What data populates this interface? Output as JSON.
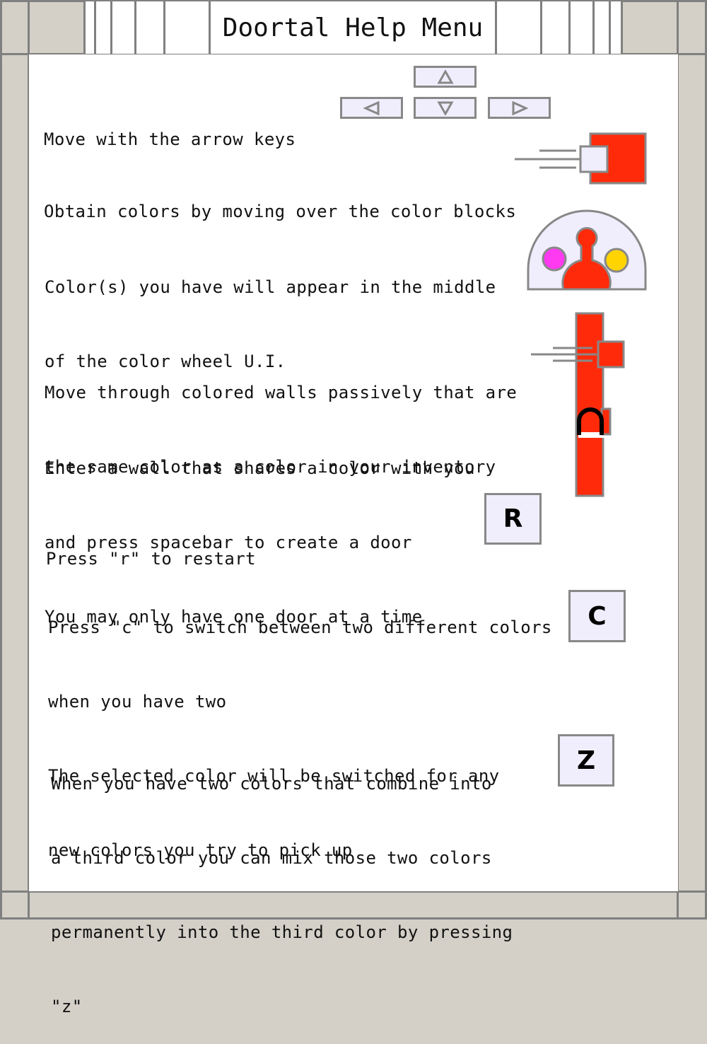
{
  "title": "Doortal Help Menu",
  "colors": {
    "frame": "#808080",
    "frame_fill": "#d4d0c8",
    "panel": "#ffffff",
    "key_fill": "#f0eefc",
    "block_red": "#ff2a0a",
    "magenta": "#ff3af0",
    "yellow": "#ffd400"
  },
  "instructions": {
    "move": [
      "Move with the arrow keys"
    ],
    "obtain": [
      "Obtain colors by moving over the color blocks"
    ],
    "wheel": [
      "Color(s) you have will appear in the middle",
      "of the color wheel U.I."
    ],
    "walls": [
      "Move through colored walls passively that are",
      "the same color as a color in your inventory"
    ],
    "door": [
      "Enter a wall that shares a color with you",
      "and press spacebar to create a door",
      "You may only have one door at a time"
    ],
    "restart": [
      "Press \"r\" to restart"
    ],
    "switch": [
      "Press \"c\" to switch between two different colors",
      "when you have two",
      "The selected color will be switched for any",
      "new colors you try to pick up"
    ],
    "mix": [
      "When you have two colors that combine into",
      "a third color you can mix those two colors",
      "permanently into the third color by pressing",
      "\"z\""
    ]
  },
  "keys": {
    "restart": "R",
    "switch": "C",
    "mix": "Z"
  },
  "icons": {
    "arrow_up": "arrow-up-icon",
    "arrow_left": "arrow-left-icon",
    "arrow_down": "arrow-down-icon",
    "arrow_right": "arrow-right-icon"
  }
}
